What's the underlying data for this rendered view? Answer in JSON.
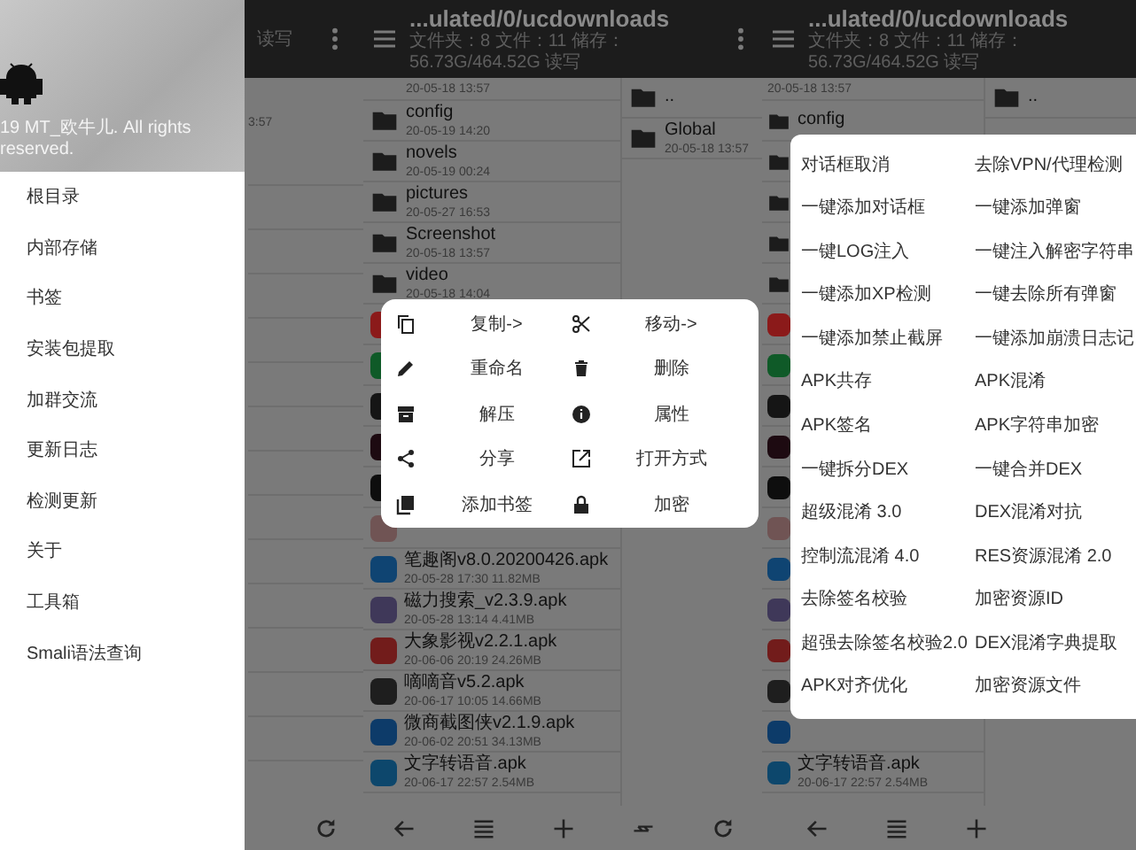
{
  "drawer_screen": {
    "background": {
      "status": "读写",
      "date_fragment": "3:57"
    },
    "caption": "19 MT_欧牛儿. All rights reserved.",
    "menu_items": [
      "根目录",
      "内部存储",
      "书签",
      "安装包提取",
      "加群交流",
      "更新日志",
      "检测更新",
      "关于",
      "工具箱",
      "Smali语法查询"
    ]
  },
  "menu_screen": {
    "title": "...ulated/0/ucdownloads",
    "subtitle": "文件夹：8 文件：11 储存：56.73G/464.52G 读写",
    "files": [
      {
        "kind": "partial",
        "info": "20-05-18 13:57"
      },
      {
        "kind": "folder",
        "name": "config",
        "info": "20-05-19 14:20"
      },
      {
        "kind": "folder",
        "name": "novels",
        "info": "20-05-19 00:24"
      },
      {
        "kind": "folder",
        "name": "pictures",
        "info": "20-05-27 16:53"
      },
      {
        "kind": "folder",
        "name": "Screenshot",
        "info": "20-05-18 13:57"
      },
      {
        "kind": "folder",
        "name": "video",
        "info": "20-05-18 14:04"
      },
      {
        "kind": "apk",
        "color": "#8b1a1a"
      },
      {
        "kind": "apk",
        "color": "#0f5a28"
      },
      {
        "kind": "apk",
        "color": "#151515"
      },
      {
        "kind": "apk",
        "color": "#1d0a11"
      },
      {
        "kind": "apk",
        "color": "#0e0e0e"
      },
      {
        "kind": "apk",
        "color": "#705454"
      },
      {
        "kind": "apk",
        "color": "#0f4472",
        "name": "笔趣阁v8.0.20200426.apk",
        "info": "20-05-28 17:30  11.82MB"
      },
      {
        "kind": "apk",
        "color": "#3f3859",
        "name": "磁力搜索_v2.3.9.apk",
        "info": "20-05-28 13:14  4.41MB"
      },
      {
        "kind": "apk",
        "color": "#721c1b",
        "name": "大象影视v2.2.1.apk",
        "info": "20-06-06 20:19  24.26MB"
      },
      {
        "kind": "apk",
        "color": "#1e1e1e",
        "name": "嘀嘀音v5.2.apk",
        "info": "20-06-17 10:05  14.66MB"
      },
      {
        "kind": "apk",
        "color": "#0d3b69",
        "name": "微商截图侠v2.1.9.apk",
        "info": "20-06-02 20:51  34.13MB"
      },
      {
        "kind": "apk",
        "color": "#0d476c",
        "name": "文字转语音.apk",
        "info": "20-06-17 22:57  2.54MB"
      }
    ],
    "side_files": [
      {
        "kind": "folder",
        "name": ".."
      },
      {
        "kind": "folder",
        "name": "Global",
        "info": "20-05-18 13:57"
      }
    ],
    "context_menu": [
      {
        "kind": "copy",
        "label": "复制->"
      },
      {
        "kind": "cut",
        "label": "移动->"
      },
      {
        "kind": "rename",
        "label": "重命名"
      },
      {
        "kind": "delete",
        "label": "删除"
      },
      {
        "kind": "extract",
        "label": "解压"
      },
      {
        "kind": "info",
        "label": "属性"
      },
      {
        "kind": "share",
        "label": "分享"
      },
      {
        "kind": "open",
        "label": "打开方式"
      },
      {
        "kind": "bookmark",
        "label": "添加书签"
      },
      {
        "kind": "lock",
        "label": "加密"
      }
    ]
  },
  "tools_screen": {
    "title": "...ulated/0/ucdownloads",
    "subtitle": "文件夹：8 文件：11 储存：56.73G/464.52G 读写",
    "files": [
      {
        "kind": "partial",
        "info": "20-05-18 13:57"
      },
      {
        "kind": "folder",
        "name": "config"
      },
      {
        "kind": "folder"
      },
      {
        "kind": "folder"
      },
      {
        "kind": "folder"
      },
      {
        "kind": "folder"
      },
      {
        "kind": "apk",
        "color": "#8b1a1a"
      },
      {
        "kind": "apk",
        "color": "#0f5a28"
      },
      {
        "kind": "apk",
        "color": "#151515"
      },
      {
        "kind": "apk",
        "color": "#1d0a11"
      },
      {
        "kind": "apk",
        "color": "#0e0e0e"
      },
      {
        "kind": "apk",
        "color": "#705454"
      },
      {
        "kind": "apk",
        "color": "#0f4472"
      },
      {
        "kind": "apk",
        "color": "#3f3859"
      },
      {
        "kind": "apk",
        "color": "#721c1b"
      },
      {
        "kind": "apk",
        "color": "#1e1e1e"
      },
      {
        "kind": "apk",
        "color": "#0d3b69"
      },
      {
        "kind": "apk",
        "color": "#0d476c",
        "name": "文字转语音.apk",
        "info": "20-06-17 22:57  2.54MB"
      }
    ],
    "side_files": [
      {
        "kind": "folder",
        "name": ".."
      }
    ],
    "tools_menu": [
      "对话框取消",
      "去除VPN/代理检测",
      "一键添加对话框",
      "一键添加弹窗",
      "一键LOG注入",
      "一键注入解密字符串",
      "一键添加XP检测",
      "一键去除所有弹窗",
      "一键添加禁止截屏",
      "一键添加崩溃日志记",
      "APK共存",
      "APK混淆",
      "APK签名",
      "APK字符串加密",
      "一键拆分DEX",
      "一键合并DEX",
      "超级混淆 3.0",
      "DEX混淆对抗",
      "控制流混淆 4.0",
      "RES资源混淆 2.0",
      "去除签名校验",
      "加密资源ID",
      "超强去除签名校验2.0",
      "DEX混淆字典提取",
      "APK对齐优化",
      "加密资源文件"
    ]
  }
}
